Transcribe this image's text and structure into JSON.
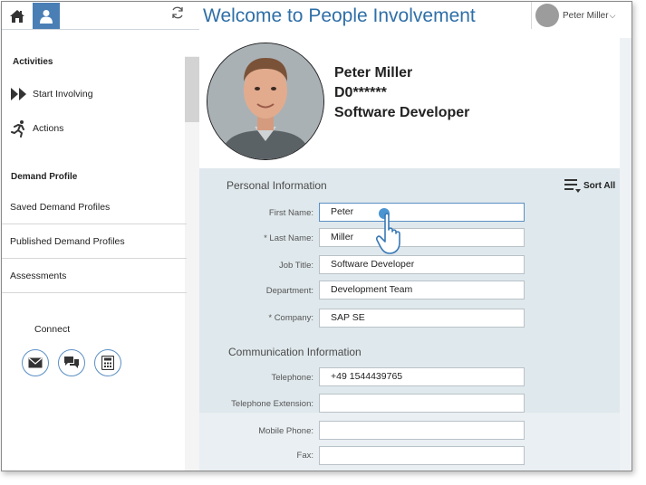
{
  "topbar": {
    "title": "Welcome to People Involvement",
    "user_name": "Peter Miller",
    "user_menu_chevron": "⌵"
  },
  "sidebar": {
    "activities_heading": "Activities",
    "start_involving": "Start Involving",
    "actions": "Actions",
    "demand_profile_heading": "Demand Profile",
    "items": [
      {
        "label": "Saved Demand Profiles"
      },
      {
        "label": "Published Demand Profiles"
      },
      {
        "label": "Assessments"
      }
    ],
    "connect_label": "Connect",
    "connect_icons": [
      "mail-icon",
      "chat-icon",
      "phone-icon"
    ]
  },
  "profile": {
    "name": "Peter Miller",
    "id": "D0******",
    "role": "Software Developer"
  },
  "personal": {
    "heading": "Personal Information",
    "sort_label": "Sort All",
    "fields": [
      {
        "label": "First Name:",
        "value": "Peter"
      },
      {
        "label": "* Last Name:",
        "value": "Miller"
      },
      {
        "label": "Job Title:",
        "value": "Software Developer"
      },
      {
        "label": "Department:",
        "value": "Development Team"
      },
      {
        "label": "* Company:",
        "value": "SAP SE"
      }
    ]
  },
  "communication": {
    "heading": "Communication Information",
    "fields": [
      {
        "label": "Telephone:",
        "value": "+49 1544439765"
      },
      {
        "label": "Telephone Extension:",
        "value": ""
      },
      {
        "label": "Mobile Phone:",
        "value": ""
      },
      {
        "label": "Fax:",
        "value": ""
      }
    ]
  },
  "colors": {
    "accent": "#4a7fb5",
    "title_blue": "#2f6fa7",
    "panel_bg": "#dfe8ec",
    "icon_ring": "#5b8fc4"
  }
}
